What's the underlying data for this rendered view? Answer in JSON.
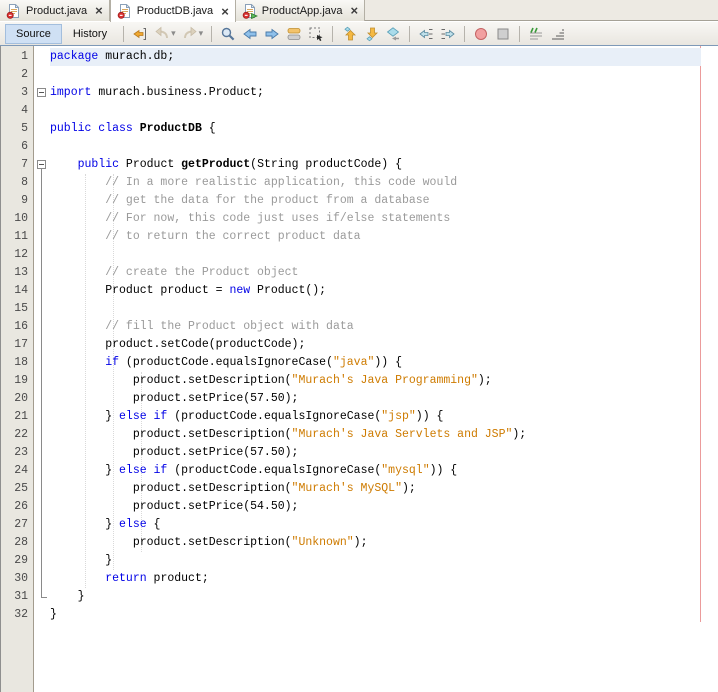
{
  "tabs": [
    {
      "label": "Product.java",
      "icon": "java-file-error-icon",
      "active": false
    },
    {
      "label": "ProductDB.java",
      "icon": "java-file-error-icon",
      "active": true
    },
    {
      "label": "ProductApp.java",
      "icon": "java-main-file-error-icon",
      "active": false
    }
  ],
  "tab_close_glyph": "×",
  "toolbar": {
    "source_label": "Source",
    "history_label": "History",
    "dropdown_glyph": "▾",
    "icon_groups": [
      [
        "last-edit-location-icon",
        "back-icon",
        "forward-icon"
      ],
      [
        "find-icon",
        "find-previous-icon",
        "find-next-icon",
        "toggle-highlight-icon",
        "rectangular-selection-icon"
      ],
      [
        "previous-bookmark-icon",
        "next-bookmark-icon",
        "toggle-bookmark-icon"
      ],
      [
        "shift-left-icon",
        "shift-right-icon"
      ],
      [
        "record-macro-icon",
        "stop-macro-icon"
      ],
      [
        "comment-icon",
        "uncomment-icon"
      ]
    ],
    "disabled_icons": [
      "back-icon",
      "forward-icon"
    ],
    "dropdown_icons": [
      "back-icon",
      "forward-icon"
    ]
  },
  "editor": {
    "caret_line": 1,
    "fold_boxes": [
      3,
      7
    ],
    "fold_range": {
      "start": 7,
      "end": 31
    },
    "colors": {
      "keyword": "#0000e6",
      "string": "#ce7b00",
      "comment": "#9a9a9a",
      "caret_row": "#e8eff8",
      "margin_line": "#eb9b9b"
    },
    "lines": [
      [
        [
          "package",
          "k"
        ],
        [
          " murach.db;",
          "p"
        ]
      ],
      [],
      [
        [
          "import",
          "k"
        ],
        [
          " murach.business.Product;",
          "p"
        ]
      ],
      [],
      [
        [
          "public class",
          "k"
        ],
        [
          " ",
          "p"
        ],
        [
          "ProductDB",
          "d"
        ],
        [
          " {",
          "p"
        ]
      ],
      [],
      [
        [
          "    ",
          "p"
        ],
        [
          "public",
          "k"
        ],
        [
          " Product ",
          "p"
        ],
        [
          "getProduct",
          "d"
        ],
        [
          "(String productCode) {",
          "p"
        ]
      ],
      [
        [
          "        // In a more realistic application, this code would",
          "c"
        ]
      ],
      [
        [
          "        // get the data for the product from a database",
          "c"
        ]
      ],
      [
        [
          "        // For now, this code just uses if/else statements",
          "c"
        ]
      ],
      [
        [
          "        // to return the correct product data",
          "c"
        ]
      ],
      [],
      [
        [
          "        // create the Product object",
          "c"
        ]
      ],
      [
        [
          "        Product product = ",
          "p"
        ],
        [
          "new",
          "k"
        ],
        [
          " Product();",
          "p"
        ]
      ],
      [],
      [
        [
          "        // fill the Product object with data",
          "c"
        ]
      ],
      [
        [
          "        product.setCode(productCode);",
          "p"
        ]
      ],
      [
        [
          "        ",
          "p"
        ],
        [
          "if",
          "k"
        ],
        [
          " (productCode.equalsIgnoreCase(",
          "p"
        ],
        [
          "\"java\"",
          "s"
        ],
        [
          ")) {",
          "p"
        ]
      ],
      [
        [
          "            product.setDescription(",
          "p"
        ],
        [
          "\"Murach's Java Programming\"",
          "s"
        ],
        [
          ");",
          "p"
        ]
      ],
      [
        [
          "            product.setPrice(57.50);",
          "p"
        ]
      ],
      [
        [
          "        } ",
          "p"
        ],
        [
          "else",
          "k"
        ],
        [
          " ",
          "p"
        ],
        [
          "if",
          "k"
        ],
        [
          " (productCode.equalsIgnoreCase(",
          "p"
        ],
        [
          "\"jsp\"",
          "s"
        ],
        [
          ")) {",
          "p"
        ]
      ],
      [
        [
          "            product.setDescription(",
          "p"
        ],
        [
          "\"Murach's Java Servlets and JSP\"",
          "s"
        ],
        [
          ");",
          "p"
        ]
      ],
      [
        [
          "            product.setPrice(57.50);",
          "p"
        ]
      ],
      [
        [
          "        } ",
          "p"
        ],
        [
          "else",
          "k"
        ],
        [
          " ",
          "p"
        ],
        [
          "if",
          "k"
        ],
        [
          " (productCode.equalsIgnoreCase(",
          "p"
        ],
        [
          "\"mysql\"",
          "s"
        ],
        [
          ")) {",
          "p"
        ]
      ],
      [
        [
          "            product.setDescription(",
          "p"
        ],
        [
          "\"Murach's MySQL\"",
          "s"
        ],
        [
          ");",
          "p"
        ]
      ],
      [
        [
          "            product.setPrice(54.50);",
          "p"
        ]
      ],
      [
        [
          "        } ",
          "p"
        ],
        [
          "else",
          "k"
        ],
        [
          " {",
          "p"
        ]
      ],
      [
        [
          "            product.setDescription(",
          "p"
        ],
        [
          "\"Unknown\"",
          "s"
        ],
        [
          ");",
          "p"
        ]
      ],
      [
        [
          "        }",
          "p"
        ]
      ],
      [
        [
          "        ",
          "p"
        ],
        [
          "return",
          "k"
        ],
        [
          " product;",
          "p"
        ]
      ],
      [
        [
          "    }",
          "p"
        ]
      ],
      [
        [
          "}",
          "p"
        ]
      ]
    ]
  }
}
